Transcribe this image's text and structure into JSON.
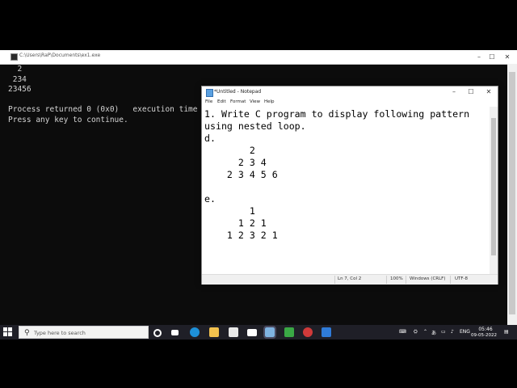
{
  "console": {
    "title": "C:\\Users\\RaP\\Documents\\ex1.exe",
    "output": "  2\n 234\n23456\n\nProcess returned 0 (0x0)   execution time : 0.0\nPress any key to continue."
  },
  "notepad": {
    "title": "*Untitled - Notepad",
    "menu": [
      "File",
      "Edit",
      "Format",
      "View",
      "Help"
    ],
    "content": "1. Write C program to display following pattern\nusing nested loop.\nd.\n        2\n      2 3 4\n    2 3 4 5 6\n\ne.\n        1\n      1 2 1\n    1 2 3 2 1",
    "status": {
      "position": "Ln 7, Col 2",
      "zoom": "100%",
      "line_endings": "Windows (CRLF)",
      "encoding": "UTF-8"
    }
  },
  "taskbar": {
    "search_placeholder": "Type here to search",
    "language": "ENG",
    "time": "05:46",
    "date": "09-05-2022"
  },
  "window_controls": {
    "minimize": "–",
    "maximize": "☐",
    "close": "✕"
  }
}
